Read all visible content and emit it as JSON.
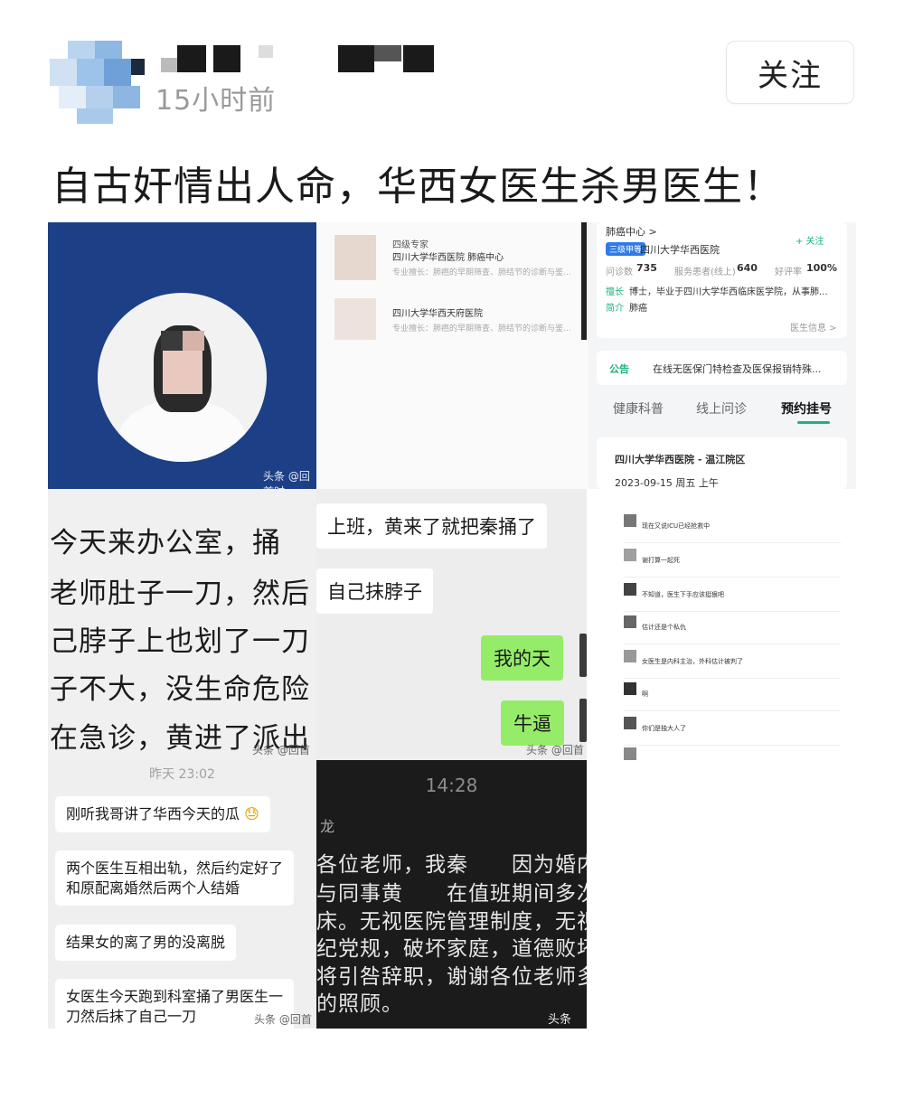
{
  "header": {
    "time_ago": "15小时前",
    "follow_label": "关注"
  },
  "post": {
    "title": "自古奸情出人命，华西女医生杀男医生！"
  },
  "watermark": "头条 @回首时",
  "tile_doctor_list": {
    "rows": [
      {
        "tag": "四级专家",
        "hospital": "四川大学华西医院  肺癌中心",
        "specialty": "专业擅长：肺癌的早期筛查、肺结节的诊断与鉴..."
      },
      {
        "tag": "",
        "hospital": "四川大学华西天府医院",
        "specialty": "专业擅长：肺癌的早期筛查、肺结节的诊断与鉴..."
      }
    ]
  },
  "tile_hospital": {
    "center": "肺癌中心 >",
    "follow": "+ 关注",
    "badge": "三级甲等",
    "hospital": "四川大学华西医院",
    "consult_label": "问诊数",
    "consult_value": "735",
    "patients_label": "服务患者(线上)",
    "patients_value": "640",
    "rating_label": "好评率",
    "rating_value": "100%",
    "skill_label": "擅长",
    "skill_text": "博士，毕业于四川大学华西临床医学院，从事肺...",
    "intro_label": "简介",
    "intro_text": "肺癌",
    "doctor_info": "医生信息 >",
    "notice_label": "公告",
    "notice_text": "在线无医保门特检查及医保报销特殊...",
    "tabs": [
      "健康科普",
      "线上问诊",
      "预约挂号"
    ],
    "campus": "四川大学华西医院 - 温江院区",
    "date": "2023-09-15 周五 上午"
  },
  "tile_text_chat": {
    "lines": [
      "今天来办公室，捅",
      "老师肚子一刀，然后",
      "己脖子上也划了一刀",
      "子不大，没生命危险",
      "在急诊，黄进了派出"
    ]
  },
  "tile_bubbles": {
    "left1": "上班，黄来了就把秦捅了",
    "left2": "自己抹脖子",
    "right1": "我的天",
    "right2": "牛逼"
  },
  "tile_comments": {
    "items": [
      {
        "text": "现在又说ICU已经抢救中"
      },
      {
        "text": "谢打算一起死"
      },
      {
        "text": "不知道，医生下手应该挺狠吧"
      },
      {
        "text": "估计还是个私仇"
      },
      {
        "text": "女医生是内科主治，外科估计被判了"
      },
      {
        "text": "啊"
      },
      {
        "text": "你们是独大人了"
      },
      {
        "text": ""
      }
    ]
  },
  "tile_chat_list": {
    "date": "昨天 23:02",
    "messages": [
      "刚听我哥讲了华西今天的瓜",
      "两个医生互相出轨，然后约定好了\n和原配离婚然后两个人结婚",
      "结果女的离了男的没离脱",
      "女医生今天跑到科室捅了男医生一\n刀然后抹了自己一刀"
    ]
  },
  "tile_announcement": {
    "clock": "14:28",
    "who": "龙",
    "lines": [
      "各位老师，我秦　　因为婚内",
      "与同事黄　　在值班期间多次",
      "床。无视医院管理制度，无视",
      "纪党规，破坏家庭，道德败坏",
      "将引咎辞职，谢谢各位老师多",
      "的照顾。"
    ]
  }
}
